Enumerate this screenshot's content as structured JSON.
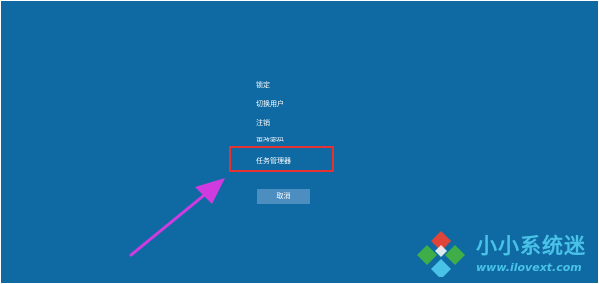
{
  "menu": {
    "items": [
      {
        "label": "锁定"
      },
      {
        "label": "切换用户"
      },
      {
        "label": "注销"
      },
      {
        "label": "更改密码"
      },
      {
        "label": "任务管理器"
      }
    ],
    "cancel_label": "取消"
  },
  "watermark": {
    "title": "小小系统迷",
    "url": "www.ilovext.com"
  },
  "colors": {
    "background": "#0f6aa3",
    "button": "#4d8ec1",
    "highlight": "#e63131",
    "arrow": "#d03be0",
    "watermark_text": "#49c2e8"
  },
  "icons": [
    "arrow-icon",
    "watermark-logo-icon"
  ]
}
